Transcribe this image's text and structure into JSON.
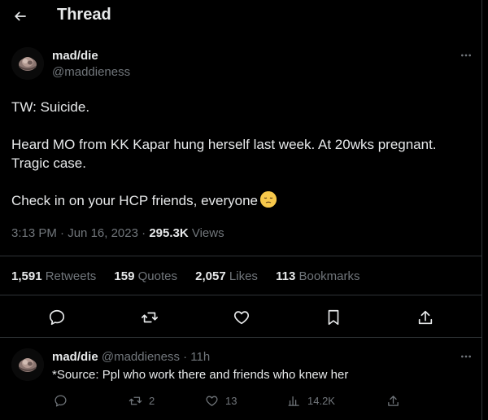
{
  "header": {
    "title": "Thread"
  },
  "tweet": {
    "author_name": "mad/die",
    "author_handle": "@maddieness",
    "text": {
      "line1": "TW: Suicide.",
      "line2": "Heard MO from KK Kapar hung herself last week. At 20wks pregnant.",
      "line3": "Tragic case.",
      "line4": "Check in on your HCP friends, everyone"
    },
    "time": "3:13 PM",
    "date": "Jun 16, 2023",
    "views_count": "295.3K",
    "views_label": "Views",
    "separator": "·",
    "stats": {
      "retweets_count": "1,591",
      "retweets_label": "Retweets",
      "quotes_count": "159",
      "quotes_label": "Quotes",
      "likes_count": "2,057",
      "likes_label": "Likes",
      "bookmarks_count": "113",
      "bookmarks_label": "Bookmarks"
    }
  },
  "reply": {
    "author_name": "mad/die",
    "author_handle": "@maddieness",
    "time_ago": "· 11h",
    "text": "*Source: Ppl who work there and friends who knew her",
    "retweets": "2",
    "likes": "13",
    "views": "14.2K"
  },
  "colors": {
    "background": "#000000",
    "text": "#e7e9ea",
    "muted": "#71767b",
    "divider": "#2f3336"
  },
  "icons": [
    "back-arrow-icon",
    "more-icon",
    "reply-icon",
    "retweet-icon",
    "like-icon",
    "bookmark-icon",
    "share-icon",
    "views-icon",
    "pensive-face-emoji"
  ]
}
